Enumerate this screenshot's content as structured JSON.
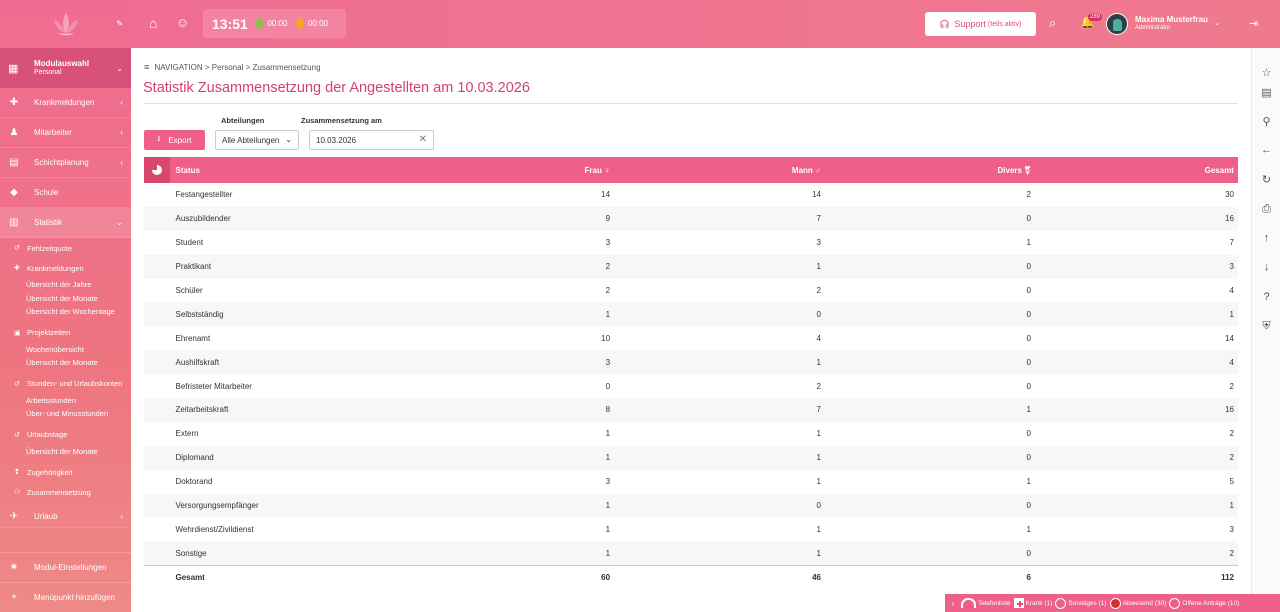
{
  "sidebar": {
    "module_title": "Modulauswahl",
    "module_sub": "Personal",
    "items": [
      {
        "label": "Krankmeldungen"
      },
      {
        "label": "Mitarbeiter"
      },
      {
        "label": "Schichtplanung"
      },
      {
        "label": "Schule"
      },
      {
        "label": "Statistik"
      }
    ],
    "statistik": {
      "fehlzeit": "Fehlzeitquote",
      "krank": "Krankmeldungen",
      "krank_subs": [
        "Übersicht der Jahre",
        "Übersicht der Monate",
        "Übersicht der Wochentage"
      ],
      "projekt": "Projektzeiten",
      "projekt_subs": [
        "Wochenübersicht",
        "Übersicht der Monate"
      ],
      "stunden": "Stunden- und Urlaubskonten",
      "stunden_subs": [
        "Arbeitsstunden",
        "Über- und Minusstunden"
      ],
      "urlaubstage": "Urlaubstage",
      "urlaubstage_subs": [
        "Übersicht der Monate"
      ],
      "zugehoerigkeit": "Zugehörigkeit",
      "zusammensetzung": "Zusammensetzung"
    },
    "urlaub": "Urlaub",
    "modul_einstellungen": "Modul-Einstellungen",
    "menupunkt": "Menüpunkt hinzufügen"
  },
  "topbar": {
    "time": "13:51",
    "green_time": "00:00",
    "orange_time": "00:00",
    "support_label": "Support",
    "support_sub": "(teils aktiv)",
    "notification_count": "289",
    "user_name": "Maxima Musterfrau",
    "user_role": "Administrator"
  },
  "breadcrumb": {
    "nav": "NAVIGATION",
    "path1": "Personal",
    "path2": "Zusammensetzung"
  },
  "page_title": "Statistik Zusammensetzung der Angestellten am 10.03.2026",
  "filters": {
    "export_label": "Export",
    "abteilungen_label": "Abteilungen",
    "abteilungen_value": "Alle Abteilungen",
    "date_label": "Zusammensetzung am",
    "date_value": "10.03.2026"
  },
  "table": {
    "headers": {
      "status": "Status",
      "frau": "Frau",
      "mann": "Mann",
      "divers": "Divers",
      "gesamt": "Gesamt"
    },
    "rows": [
      {
        "status": "Festangestellter",
        "frau": "14",
        "mann": "14",
        "divers": "2",
        "gesamt": "30"
      },
      {
        "status": "Auszubildender",
        "frau": "9",
        "mann": "7",
        "divers": "0",
        "gesamt": "16"
      },
      {
        "status": "Student",
        "frau": "3",
        "mann": "3",
        "divers": "1",
        "gesamt": "7"
      },
      {
        "status": "Praktikant",
        "frau": "2",
        "mann": "1",
        "divers": "0",
        "gesamt": "3"
      },
      {
        "status": "Schüler",
        "frau": "2",
        "mann": "2",
        "divers": "0",
        "gesamt": "4"
      },
      {
        "status": "Selbstständig",
        "frau": "1",
        "mann": "0",
        "divers": "0",
        "gesamt": "1"
      },
      {
        "status": "Ehrenamt",
        "frau": "10",
        "mann": "4",
        "divers": "0",
        "gesamt": "14"
      },
      {
        "status": "Aushilfskraft",
        "frau": "3",
        "mann": "1",
        "divers": "0",
        "gesamt": "4"
      },
      {
        "status": "Befristeter Mitarbeiter",
        "frau": "0",
        "mann": "2",
        "divers": "0",
        "gesamt": "2"
      },
      {
        "status": "Zeitarbeitskraft",
        "frau": "8",
        "mann": "7",
        "divers": "1",
        "gesamt": "16"
      },
      {
        "status": "Extern",
        "frau": "1",
        "mann": "1",
        "divers": "0",
        "gesamt": "2"
      },
      {
        "status": "Diplomand",
        "frau": "1",
        "mann": "1",
        "divers": "0",
        "gesamt": "2"
      },
      {
        "status": "Doktorand",
        "frau": "3",
        "mann": "1",
        "divers": "1",
        "gesamt": "5"
      },
      {
        "status": "Versorgungsempfänger",
        "frau": "1",
        "mann": "0",
        "divers": "0",
        "gesamt": "1"
      },
      {
        "status": "Wehrdienst/Zivildienst",
        "frau": "1",
        "mann": "1",
        "divers": "1",
        "gesamt": "3"
      },
      {
        "status": "Sonstige",
        "frau": "1",
        "mann": "1",
        "divers": "0",
        "gesamt": "2"
      }
    ],
    "footer": {
      "status": "Gesamt",
      "frau": "60",
      "mann": "46",
      "divers": "6",
      "gesamt": "112"
    }
  },
  "statusbar": {
    "telefonliste": "Telefonliste",
    "krank": "Krank (1)",
    "sonstiges": "Sonstiges (1)",
    "abwesend": "Abwesend (30)",
    "offene": "Offene Anträge (10)"
  },
  "colors": {
    "accent": "#ee5f8a",
    "title": "#d4416f"
  }
}
